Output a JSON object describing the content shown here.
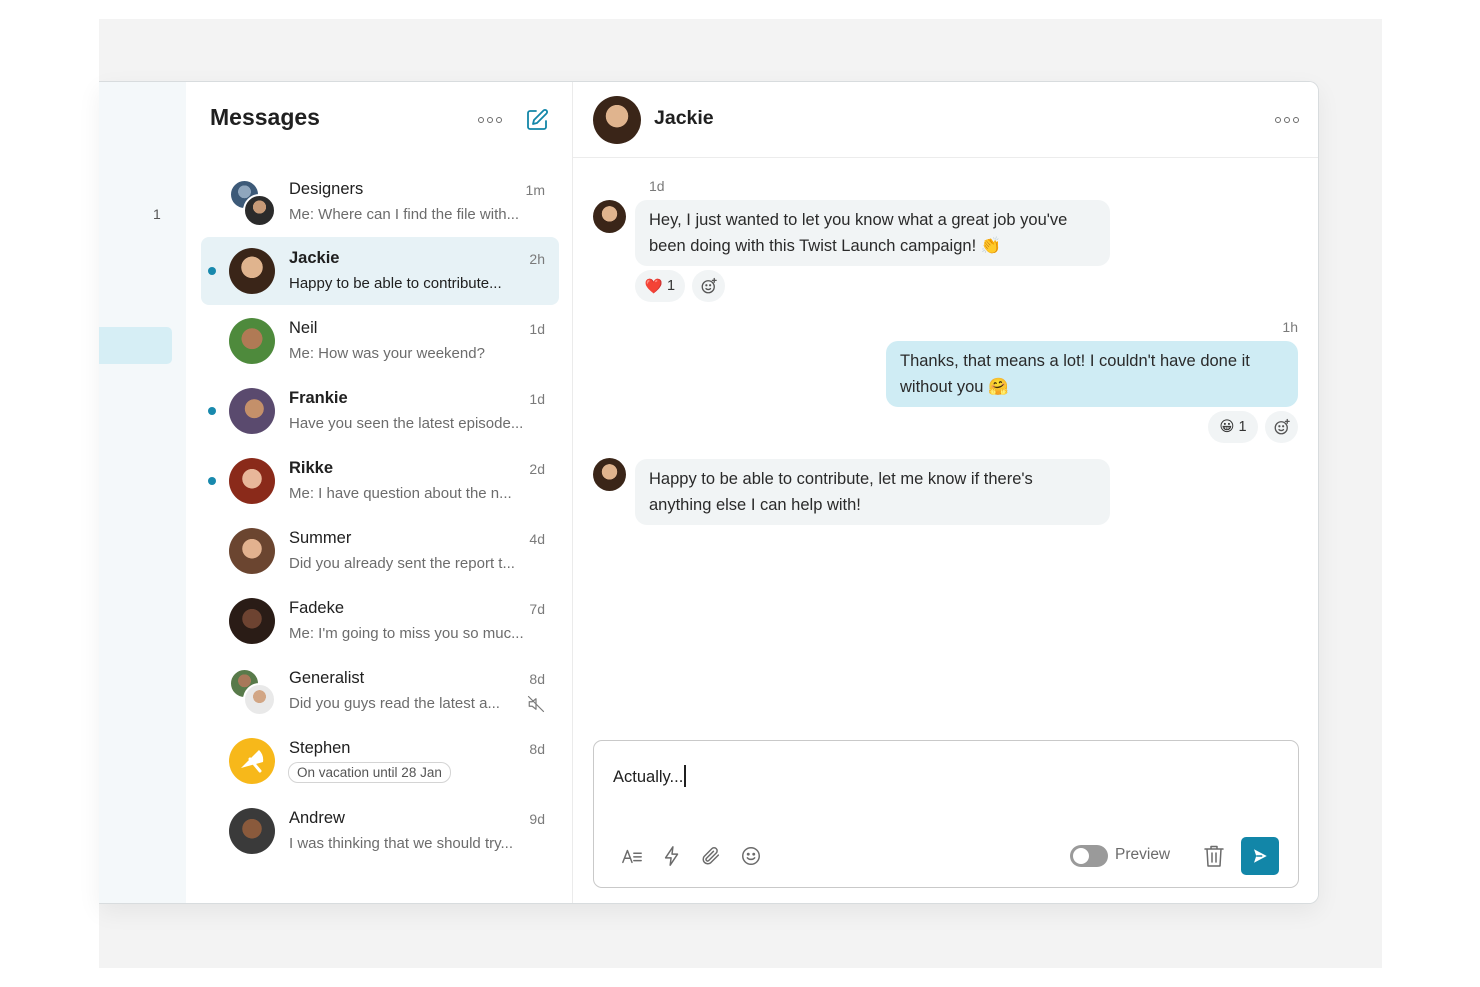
{
  "sidebar": {
    "count": "1"
  },
  "list": {
    "title": "Messages",
    "conversations": [
      {
        "name": "Designers",
        "time": "1m",
        "preview": "Me: Where can I find the file with..."
      },
      {
        "name": "Jackie",
        "time": "2h",
        "preview": "Happy to be able to contribute..."
      },
      {
        "name": "Neil",
        "time": "1d",
        "preview": "Me: How was your weekend?"
      },
      {
        "name": "Frankie",
        "time": "1d",
        "preview": "Have you seen the latest episode..."
      },
      {
        "name": "Rikke",
        "time": "2d",
        "preview": "Me: I have question about the n..."
      },
      {
        "name": "Summer",
        "time": "4d",
        "preview": "Did you already sent the report t..."
      },
      {
        "name": "Fadeke",
        "time": "7d",
        "preview": "Me: I'm going to miss you so muc..."
      },
      {
        "name": "Generalist",
        "time": "8d",
        "preview": "Did you guys read the latest a..."
      },
      {
        "name": "Stephen",
        "time": "8d",
        "status": "On vacation until 28 Jan"
      },
      {
        "name": "Andrew",
        "time": "9d",
        "preview": "I was thinking that we should try..."
      }
    ]
  },
  "chat": {
    "name": "Jackie",
    "messages": [
      {
        "time": "1d",
        "text": "Hey, I just wanted to let you know what a great job you've been doing with this Twist Launch campaign! 👏",
        "reaction": "❤️",
        "reaction_count": "1"
      },
      {
        "time": "1h",
        "text": "Thanks, that means a lot! I couldn't have done it without you 🤗",
        "reaction": "😀",
        "reaction_count": "1"
      },
      {
        "text": "Happy to be able to contribute, let me know if there's anything else I can help with!"
      }
    ],
    "composer": {
      "value": "Actually...",
      "preview_label": "Preview"
    }
  },
  "colors": {
    "accent": "#1286a8",
    "unread": "#1889ad",
    "own_bubble": "#cfecf4",
    "bubble": "#f1f4f5"
  }
}
